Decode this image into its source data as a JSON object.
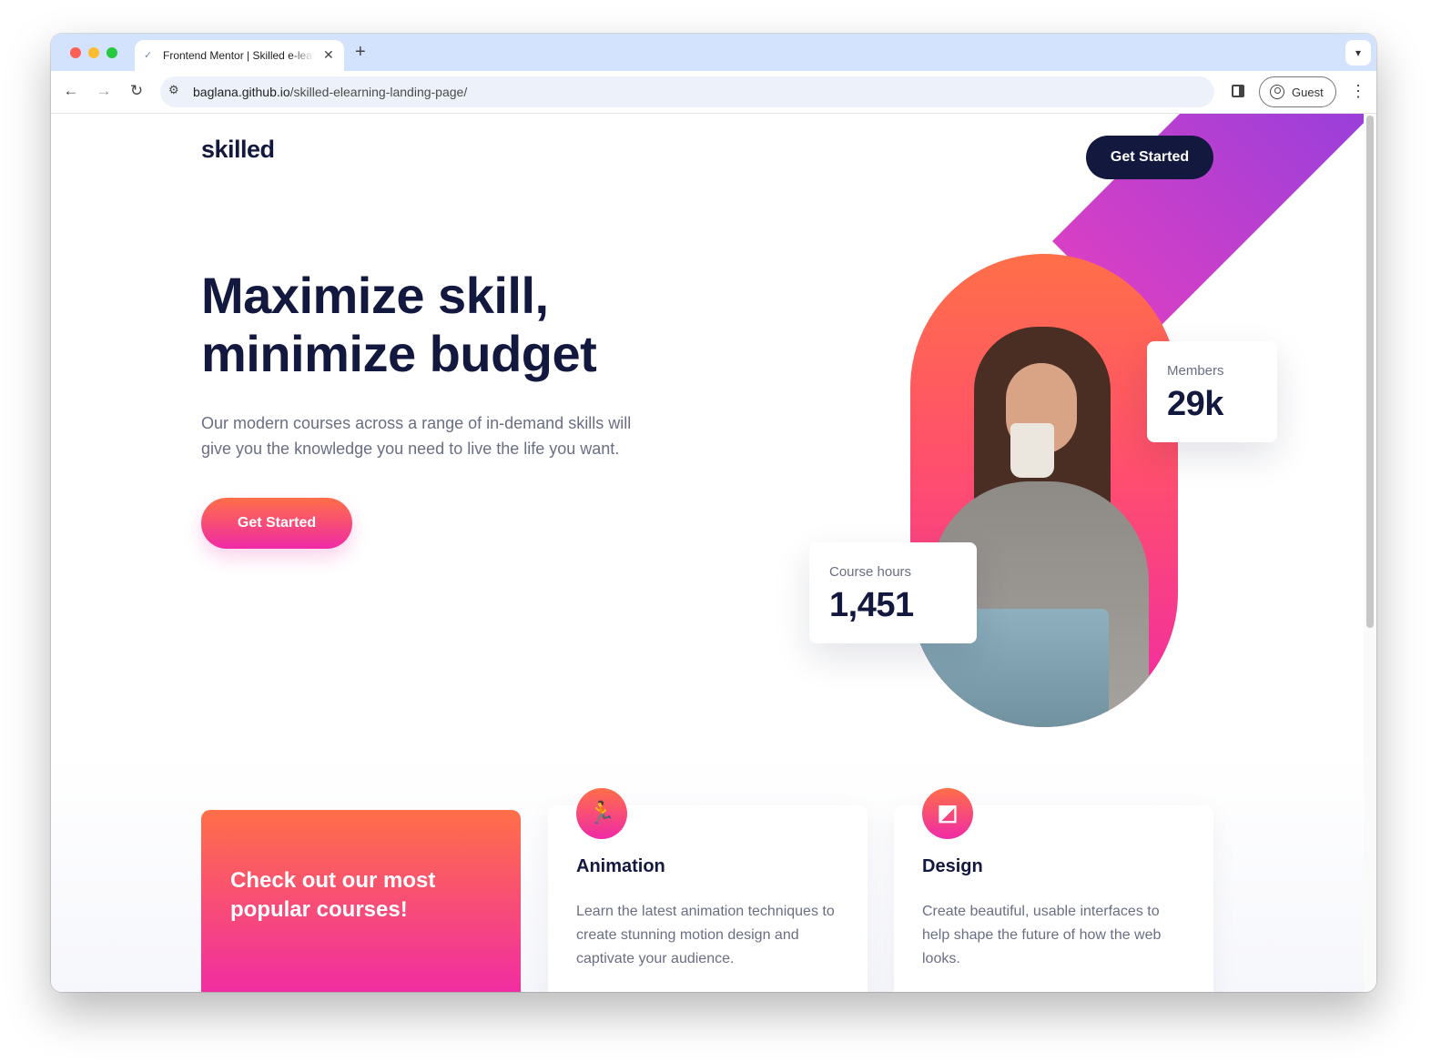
{
  "browser": {
    "tab": {
      "title": "Frontend Mentor | Skilled e-learning landing page",
      "favicon": "frontend-mentor-icon"
    },
    "url": {
      "host": "baglana.github.io",
      "path": "/skilled-elearning-landing-page/"
    },
    "profile_label": "Guest",
    "icons": {
      "back": "←",
      "forward": "→",
      "reload": "↻",
      "close": "✕",
      "new_tab": "+",
      "dropdown": "⌄",
      "menu": "⋮",
      "site_info": "⚙"
    }
  },
  "page": {
    "logo": "skilled",
    "header_cta": "Get Started",
    "hero": {
      "title": "Maximize skill, minimize budget",
      "subtitle": "Our modern courses across a range of in-demand skills will give you the knowledge you need to live the life you want.",
      "cta": "Get Started"
    },
    "stats": {
      "members": {
        "label": "Members",
        "value": "29k"
      },
      "hours": {
        "label": "Course hours",
        "value": "1,451"
      }
    },
    "courses": {
      "promo": "Check out our most popular courses!",
      "items": [
        {
          "title": "Animation",
          "icon": "running-figure-icon",
          "glyph": "🏃",
          "description": "Learn the latest animation techniques to create stunning motion design and captivate your audience."
        },
        {
          "title": "Design",
          "icon": "design-frame-icon",
          "glyph": "◩",
          "description": "Create beautiful, usable interfaces to help shape the future of how the web looks."
        }
      ]
    }
  },
  "colors": {
    "navy": "#13183f",
    "gradient_start": "#ff6f48",
    "gradient_end": "#f02aa6",
    "stripe_purple": "#6e46e3",
    "text_muted": "#6a6e85"
  }
}
